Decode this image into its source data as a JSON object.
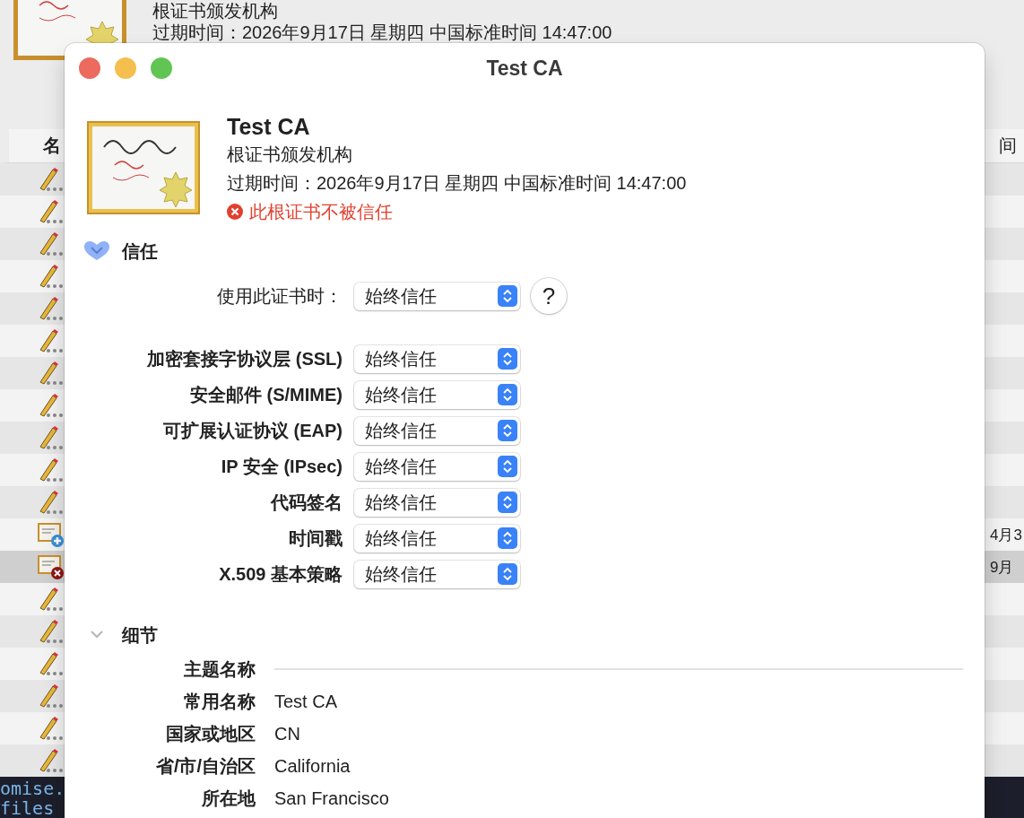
{
  "background": {
    "header": {
      "kind": "根证书颁发机构",
      "expiry": "过期时间：2026年9月17日 星期四 中国标准时间 14:47:00"
    },
    "columns": [
      "名",
      "间"
    ],
    "rows": [
      {
        "kind": "pencil",
        "selected": false
      },
      {
        "kind": "pencil",
        "selected": false
      },
      {
        "kind": "pencil",
        "selected": false
      },
      {
        "kind": "pencil",
        "selected": false
      },
      {
        "kind": "pencil",
        "selected": false
      },
      {
        "kind": "pencil",
        "selected": false
      },
      {
        "kind": "pencil",
        "selected": false
      },
      {
        "kind": "pencil",
        "selected": false
      },
      {
        "kind": "pencil",
        "selected": false
      },
      {
        "kind": "pencil",
        "selected": false
      },
      {
        "kind": "pencil",
        "selected": false
      },
      {
        "kind": "certificate-plus",
        "selected": false,
        "date": "4月3"
      },
      {
        "kind": "certificate-error",
        "selected": true,
        "date": "9月"
      },
      {
        "kind": "pencil",
        "selected": false
      },
      {
        "kind": "pencil",
        "selected": false
      },
      {
        "kind": "pencil",
        "selected": false
      },
      {
        "kind": "pencil",
        "selected": false
      },
      {
        "kind": "pencil",
        "selected": false
      },
      {
        "kind": "pencil",
        "selected": false
      }
    ],
    "terminal": [
      "omise.",
      "files"
    ]
  },
  "window": {
    "title": "Test CA"
  },
  "certificate": {
    "name": "Test CA",
    "kind": "根证书颁发机构",
    "expiry": "过期时间：2026年9月17日 星期四 中国标准时间 14:47:00",
    "status": "此根证书不被信任"
  },
  "trust": {
    "title": "信任",
    "expanded": true,
    "hovered": true,
    "when_using": {
      "label": "使用此证书时：",
      "value": "始终信任"
    },
    "help": "?",
    "policies": [
      {
        "label": "加密套接字协议层 (SSL)",
        "value": "始终信任"
      },
      {
        "label": "安全邮件 (S/MIME)",
        "value": "始终信任"
      },
      {
        "label": "可扩展认证协议 (EAP)",
        "value": "始终信任"
      },
      {
        "label": "IP 安全 (IPsec)",
        "value": "始终信任"
      },
      {
        "label": "代码签名",
        "value": "始终信任"
      },
      {
        "label": "时间戳",
        "value": "始终信任"
      },
      {
        "label": "X.509 基本策略",
        "value": "始终信任"
      }
    ]
  },
  "details": {
    "title": "细节",
    "expanded": true,
    "hovered": false,
    "rows": [
      {
        "kind": "heading",
        "label": "主题名称"
      },
      {
        "kind": "field",
        "label": "常用名称",
        "value": "Test CA"
      },
      {
        "kind": "field",
        "label": "国家或地区",
        "value": "CN"
      },
      {
        "kind": "field",
        "label": "省/市/自治区",
        "value": "California"
      },
      {
        "kind": "field",
        "label": "所在地",
        "value": "San Francisco"
      }
    ]
  }
}
